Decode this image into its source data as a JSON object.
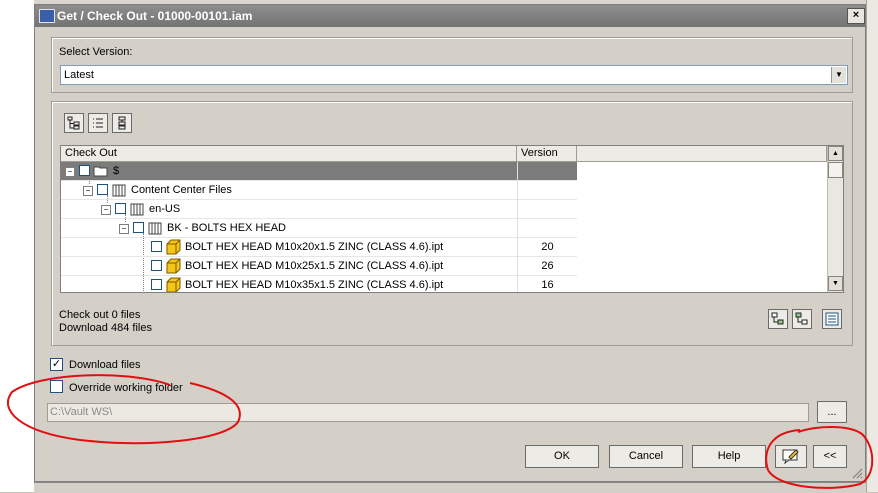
{
  "window": {
    "title": "Get / Check Out - 01000-00101.iam",
    "close_glyph": "×"
  },
  "version": {
    "label": "Select Version:",
    "value": "Latest"
  },
  "toolbar": {
    "icons": [
      "tree-view-icon",
      "list-view-icon",
      "hierarchy-view-icon"
    ]
  },
  "grid": {
    "columns": [
      "Check Out",
      "Version"
    ],
    "rows": [
      {
        "label": "$",
        "version": "",
        "selected": true
      },
      {
        "label": "Content Center Files",
        "version": ""
      },
      {
        "label": "en-US",
        "version": ""
      },
      {
        "label": "BK - BOLTS HEX HEAD",
        "version": ""
      },
      {
        "label": "BOLT HEX HEAD M10x20x1.5 ZINC (CLASS 4.6).ipt",
        "version": "20"
      },
      {
        "label": "BOLT HEX HEAD M10x25x1.5 ZINC (CLASS 4.6).ipt",
        "version": "26"
      },
      {
        "label": "BOLT HEX HEAD M10x35x1.5 ZINC (CLASS 4.6).ipt",
        "version": "16"
      }
    ]
  },
  "summary": {
    "checkout": "Check out 0 files",
    "download": "Download 484 files"
  },
  "options": {
    "download_files": {
      "label": "Download files",
      "checked": true,
      "mark": "✓"
    },
    "override_folder": {
      "label": "Override working folder",
      "checked": false
    },
    "path": "C:\\Vault WS\\",
    "browse": "..."
  },
  "buttons": {
    "ok": "OK",
    "cancel": "Cancel",
    "help": "Help",
    "collapse": "<<"
  },
  "colors": {
    "annotation": "#e01010",
    "selected_row": "#7b7b7b"
  }
}
